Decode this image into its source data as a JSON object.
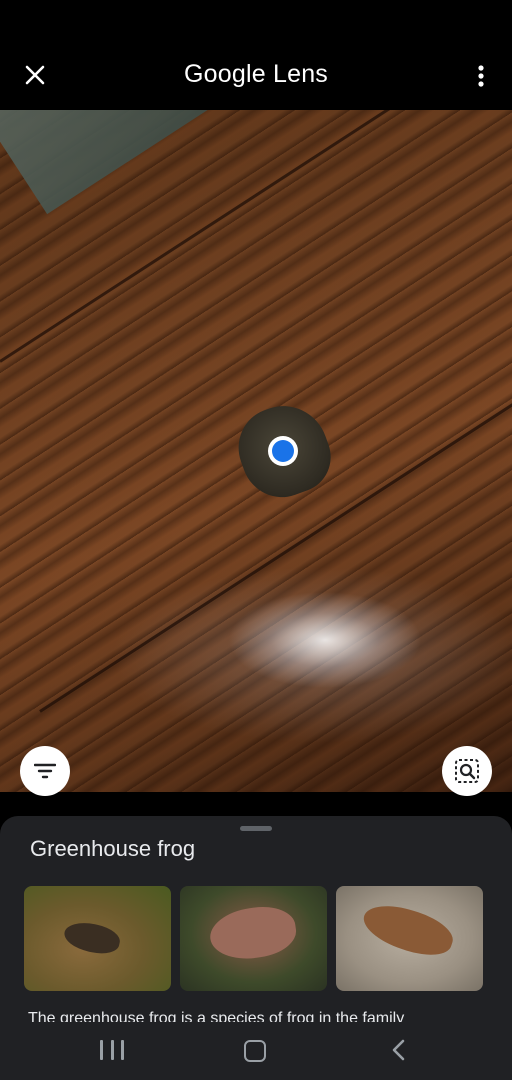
{
  "app": {
    "brand": "Google",
    "product": "Lens"
  },
  "toolbar": {
    "close_icon": "close-icon",
    "menu_icon": "more-vert-icon"
  },
  "photo": {
    "subject": "frog on wooden floor"
  },
  "controls": {
    "filter_icon": "filter-icon",
    "search_region_icon": "search-region-icon"
  },
  "result": {
    "title": "Greenhouse frog",
    "snippet": "The greenhouse frog is a species of frog in the family",
    "thumbnails": [
      "frog-thumbnail-1",
      "frog-thumbnail-2",
      "frog-thumbnail-3"
    ]
  },
  "navbar": {
    "recents_icon": "recents-icon",
    "home_icon": "home-icon",
    "back_icon": "back-icon"
  }
}
